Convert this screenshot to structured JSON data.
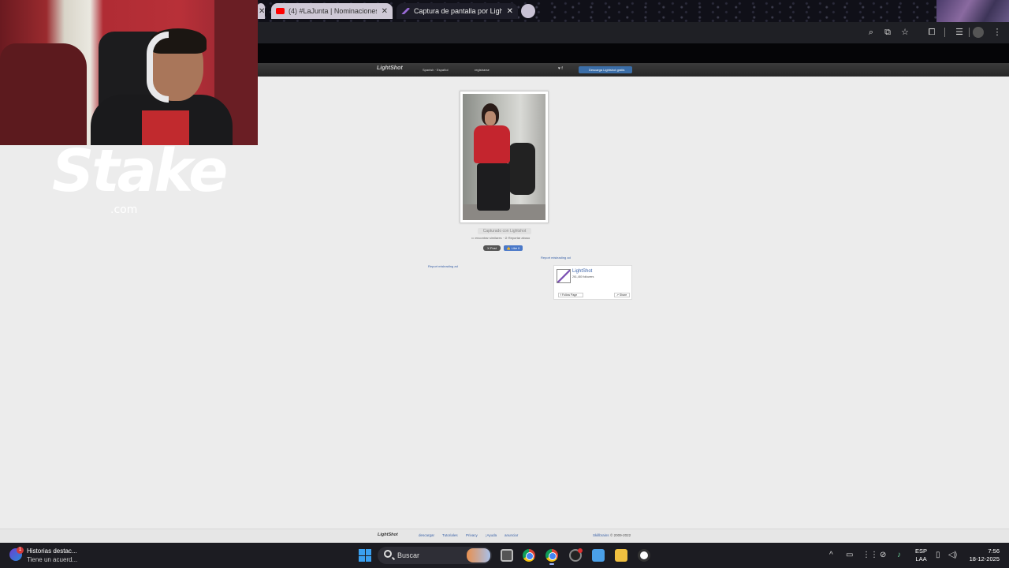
{
  "browser": {
    "tabs": [
      {
        "label": "(4) #LaJunta | Nominaciones Pr",
        "favicon_color": "#ff0000",
        "active": false
      },
      {
        "label": "Captura de pantalla por Lightshot",
        "favicon_color": "#9b6bd8",
        "active": true
      }
    ],
    "toolbar_icons": [
      "zoom-icon",
      "install-icon",
      "bookmark-star-icon",
      "extensions-icon",
      "media-icon",
      "profile-icon",
      "more-icon"
    ]
  },
  "lightshot": {
    "logo": "LightShot",
    "language": "Spanish · Español",
    "register": "registrarse",
    "social": "♥ f",
    "download_button": "Descarga Lightshot gratis",
    "caption": "Capturado con Lightshot",
    "sublinks": "▭ encontrar similares · ⊘ Reportar abuso",
    "post_button": "X Post",
    "like_button": "👍 Like 0",
    "report_ad_1": "Report misleading ad",
    "report_ad_2": "Report misleading ad",
    "fb": {
      "name": "LightShot",
      "followers": "261,480 followers",
      "follow": "f Follow Page",
      "share": "↗ Share"
    },
    "footer": {
      "logo": "LightShot",
      "links": [
        "descargar",
        "Tutoriales",
        "Privacy",
        "¡Ayuda",
        "anunciar"
      ],
      "company": "Skillbrains",
      "copyright": "© 2009-2022"
    }
  },
  "overlay": {
    "brand": "Stake",
    "brand_suffix": ".com"
  },
  "taskbar": {
    "notification_title": "Historias destac...",
    "notification_sub": "Tiene un acuerd...",
    "notification_badge": "1",
    "search_placeholder": "Buscar",
    "lang_top": "ESP",
    "lang_bottom": "LAA",
    "time": "7:56",
    "date": "18-12-2025"
  }
}
